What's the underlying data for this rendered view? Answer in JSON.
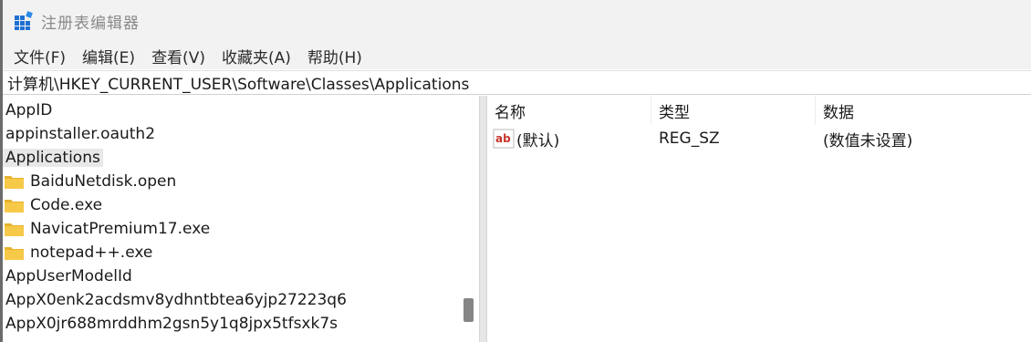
{
  "window": {
    "title": "注册表编辑器"
  },
  "menu": [
    {
      "label": "文件(F)"
    },
    {
      "label": "编辑(E)"
    },
    {
      "label": "查看(V)"
    },
    {
      "label": "收藏夹(A)"
    },
    {
      "label": "帮助(H)"
    }
  ],
  "address": {
    "path": "计算机\\HKEY_CURRENT_USER\\Software\\Classes\\Applications"
  },
  "tree": {
    "items": [
      {
        "label": "AppID",
        "type": "key"
      },
      {
        "label": "appinstaller.oauth2",
        "type": "key"
      },
      {
        "label": "Applications",
        "type": "key",
        "selected": true
      },
      {
        "label": "BaiduNetdisk.open",
        "type": "folder"
      },
      {
        "label": "Code.exe",
        "type": "folder"
      },
      {
        "label": "NavicatPremium17.exe",
        "type": "folder"
      },
      {
        "label": "notepad++.exe",
        "type": "folder"
      },
      {
        "label": "AppUserModelId",
        "type": "key"
      },
      {
        "label": "AppX0enk2acdsmv8ydhntbtea6yjp27223q6",
        "type": "key"
      },
      {
        "label": "AppX0jr688mrddhm2gsn5y1q8jpx5tfsxk7s",
        "type": "key"
      }
    ],
    "scroll_position": 0.82
  },
  "list": {
    "columns": [
      {
        "label": "名称"
      },
      {
        "label": "类型"
      },
      {
        "label": "数据"
      }
    ],
    "rows": [
      {
        "name": "(默认)",
        "type": "REG_SZ",
        "data": "(数值未设置)",
        "icon": "string-value-icon"
      }
    ]
  },
  "colors": {
    "folder": "#f7c948",
    "folder_dark": "#e6b22e",
    "selection": "#e8e8e8",
    "chrome": "#f2f2f2",
    "value_icon_red": "#c8332b"
  }
}
